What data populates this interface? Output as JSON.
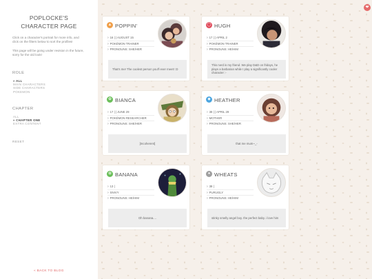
{
  "sidebar": {
    "title": "POPLOCKE'S CHARACTER PAGE",
    "intro_1": "Click on a character's portrait for more info, and click on the filters below to sort the profiles!",
    "intro_2": "This page will be going under revision in the future, sorry for the old look!",
    "role_heading": "ROLE",
    "role_filters": [
      "» ALL",
      "MAIN CHARACTERS",
      "SIDE CHARACTERS",
      "POKEMON"
    ],
    "chapter_heading": "CHAPTER",
    "chapter_filters": [
      "ALL",
      "» CHAPTER ONE",
      "EXTRA CONTENT"
    ],
    "reset_label": "RESET",
    "back_label": "« BACK TO BLOG"
  },
  "heart_icon": "heart-icon",
  "cards": [
    {
      "name": "POPPIN'",
      "type_color": "#f0a04b",
      "type_icon": "fire-icon",
      "info": [
        "16 | | AUGUST 15",
        "POKÉMON TRAINER",
        "PRONOUNS: SHE/HER"
      ],
      "quote": "That's me! The coolest person you'll ever meet! :D"
    },
    {
      "name": "HUGH",
      "type_color": "#e04a5a",
      "type_icon": "pokeball-icon",
      "info": [
        "17 | | APRIL 2",
        "POKÉMON TRAINER",
        "PRONOUNS: HE/HIM"
      ],
      "quote": "This nerd is my friend. We play D&D on fridays, he plays a barbarian while I play a significantly cooler character :-"
    },
    {
      "name": "BIANCA",
      "type_color": "#6cbf5b",
      "type_icon": "leaf-icon",
      "info": [
        "17 | | JUNE 29",
        "POKÉMON RESEARCHER",
        "PRONOUNS: SHE/HER"
      ],
      "quote": "[Incoherent]"
    },
    {
      "name": "HEATHER",
      "type_color": "#4ca6e0",
      "type_icon": "water-drop-icon",
      "info": [
        "38 | | APRIL 29",
        "MOTHER",
        "PRONOUNS: SHE/HER"
      ],
      "quote": "that me mum~_-"
    },
    {
      "name": "BANANA",
      "type_color": "#6cbf5b",
      "type_icon": "leaf-icon",
      "info": [
        "13 |",
        "SNIVY",
        "PRONOUNS: HE/HIM"
      ],
      "quote": "Oh banana...."
    },
    {
      "name": "WHEATS",
      "type_color": "#a0a0a0",
      "type_icon": "normal-type-icon",
      "info": [
        "38 |",
        "PURUGLY",
        "PRONOUNS: HE/HIM"
      ],
      "quote": "stinky smelly angel boy. the perfect baby. i love him"
    }
  ]
}
